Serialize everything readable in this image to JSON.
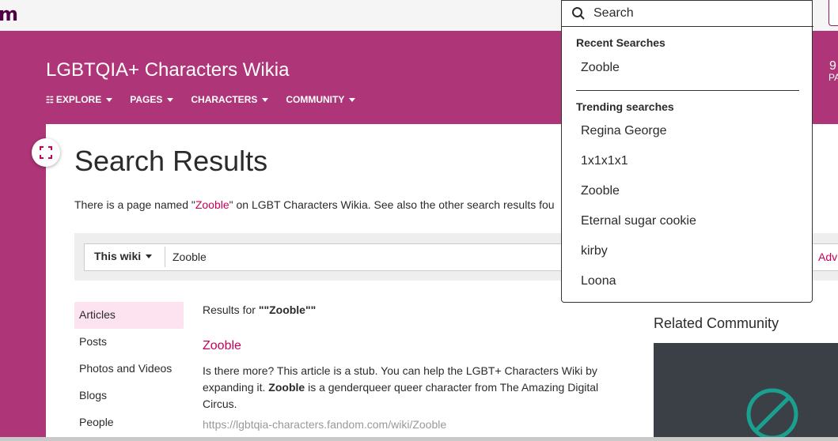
{
  "topbar": {
    "logo": "m"
  },
  "wiki": {
    "title": "LGBTQIA+ Characters Wikia",
    "nav": [
      {
        "label": "Explore"
      },
      {
        "label": "Pages"
      },
      {
        "label": "Characters"
      },
      {
        "label": "Community"
      }
    ],
    "right_number": "9",
    "right_label": "PA"
  },
  "page": {
    "title": "Search Results",
    "intro_before": "There is a page named \"",
    "intro_link": "Zooble",
    "intro_after": "\" on LGBT Characters Wikia. See also the other search results fou"
  },
  "searchbar": {
    "scope": "This wiki",
    "query": "Zooble",
    "advanced": "Adv"
  },
  "sidebar": {
    "items": [
      {
        "label": "Articles",
        "active": true
      },
      {
        "label": "Posts"
      },
      {
        "label": "Photos and Videos"
      },
      {
        "label": "Blogs"
      },
      {
        "label": "People"
      }
    ]
  },
  "results": {
    "results_for_label": "Results for ",
    "results_for_query": "\"\"Zooble\"\"",
    "items": [
      {
        "title": "Zooble",
        "snippet_before": "Is there more? This article is a stub. You can help the LGBT+ Characters Wiki by expanding it. ",
        "snippet_bold": "Zooble",
        "snippet_after": " is a genderqueer queer character from The Amazing Digital Circus.",
        "url": "https://lgbtqia-characters.fandom.com/wiki/Zooble"
      }
    ]
  },
  "related": {
    "heading": "Related Community"
  },
  "dropdown": {
    "search_placeholder": "Search",
    "recent_heading": "Recent Searches",
    "recent": [
      "Zooble"
    ],
    "trending_heading": "Trending searches",
    "trending": [
      "Regina George",
      "1x1x1x1",
      "Zooble",
      "Eternal sugar cookie",
      "kirby",
      "Loona"
    ]
  },
  "colors": {
    "brand": "#ad3578",
    "link": "#c8005a",
    "logo": "#520044",
    "related_accent": "#1aa090"
  }
}
